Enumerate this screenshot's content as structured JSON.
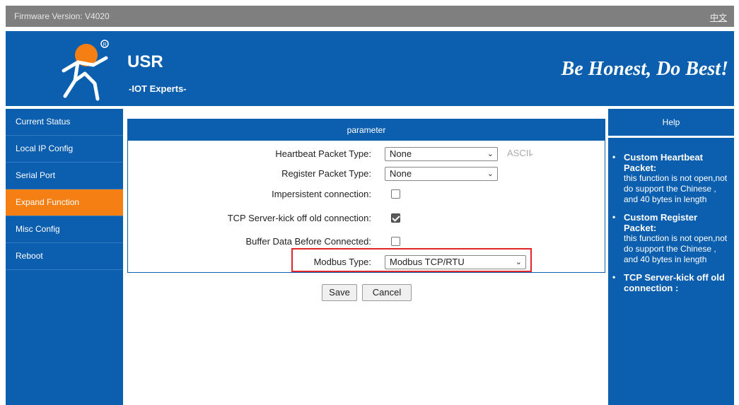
{
  "topbar": {
    "firmware": "Firmware Version: V4020",
    "language": "中文"
  },
  "header": {
    "brand": "USR",
    "subbrand": "-IOT Experts-",
    "slogan": "Be Honest, Do Best!"
  },
  "sidebar": {
    "items": [
      {
        "label": "Current Status"
      },
      {
        "label": "Local IP Config"
      },
      {
        "label": "Serial Port"
      },
      {
        "label": "Expand Function"
      },
      {
        "label": "Misc Config"
      },
      {
        "label": "Reboot"
      }
    ]
  },
  "panel": {
    "title": "parameter",
    "heartbeat": {
      "label": "Heartbeat Packet Type:",
      "value": "None",
      "ascii": "ASCII"
    },
    "register": {
      "label": "Register Packet Type:",
      "value": "None"
    },
    "impersistent": {
      "label": "Impersistent connection:",
      "checked": false
    },
    "kickoff": {
      "label": "TCP Server-kick off old connection:",
      "checked": true
    },
    "buffer": {
      "label": "Buffer Data Before Connected:",
      "checked": false
    },
    "modbus": {
      "label": "Modbus Type:",
      "value": "Modbus TCP/RTU"
    }
  },
  "buttons": {
    "save": "Save",
    "cancel": "Cancel"
  },
  "help": {
    "title": "Help",
    "items": [
      {
        "title": "Custom Heartbeat Packet:",
        "desc": "this function is not open,not do support the Chinese , and 40 bytes in length"
      },
      {
        "title": "Custom Register Packet:",
        "desc": "this function is not open,not do support the Chinese , and 40 bytes in length"
      },
      {
        "title": "TCP Server-kick off old connection :",
        "desc": ""
      }
    ]
  },
  "colors": {
    "primary": "#0b5fae",
    "active": "#f57f13",
    "highlight": "#e0252c",
    "topbar": "#7f7f7f"
  }
}
